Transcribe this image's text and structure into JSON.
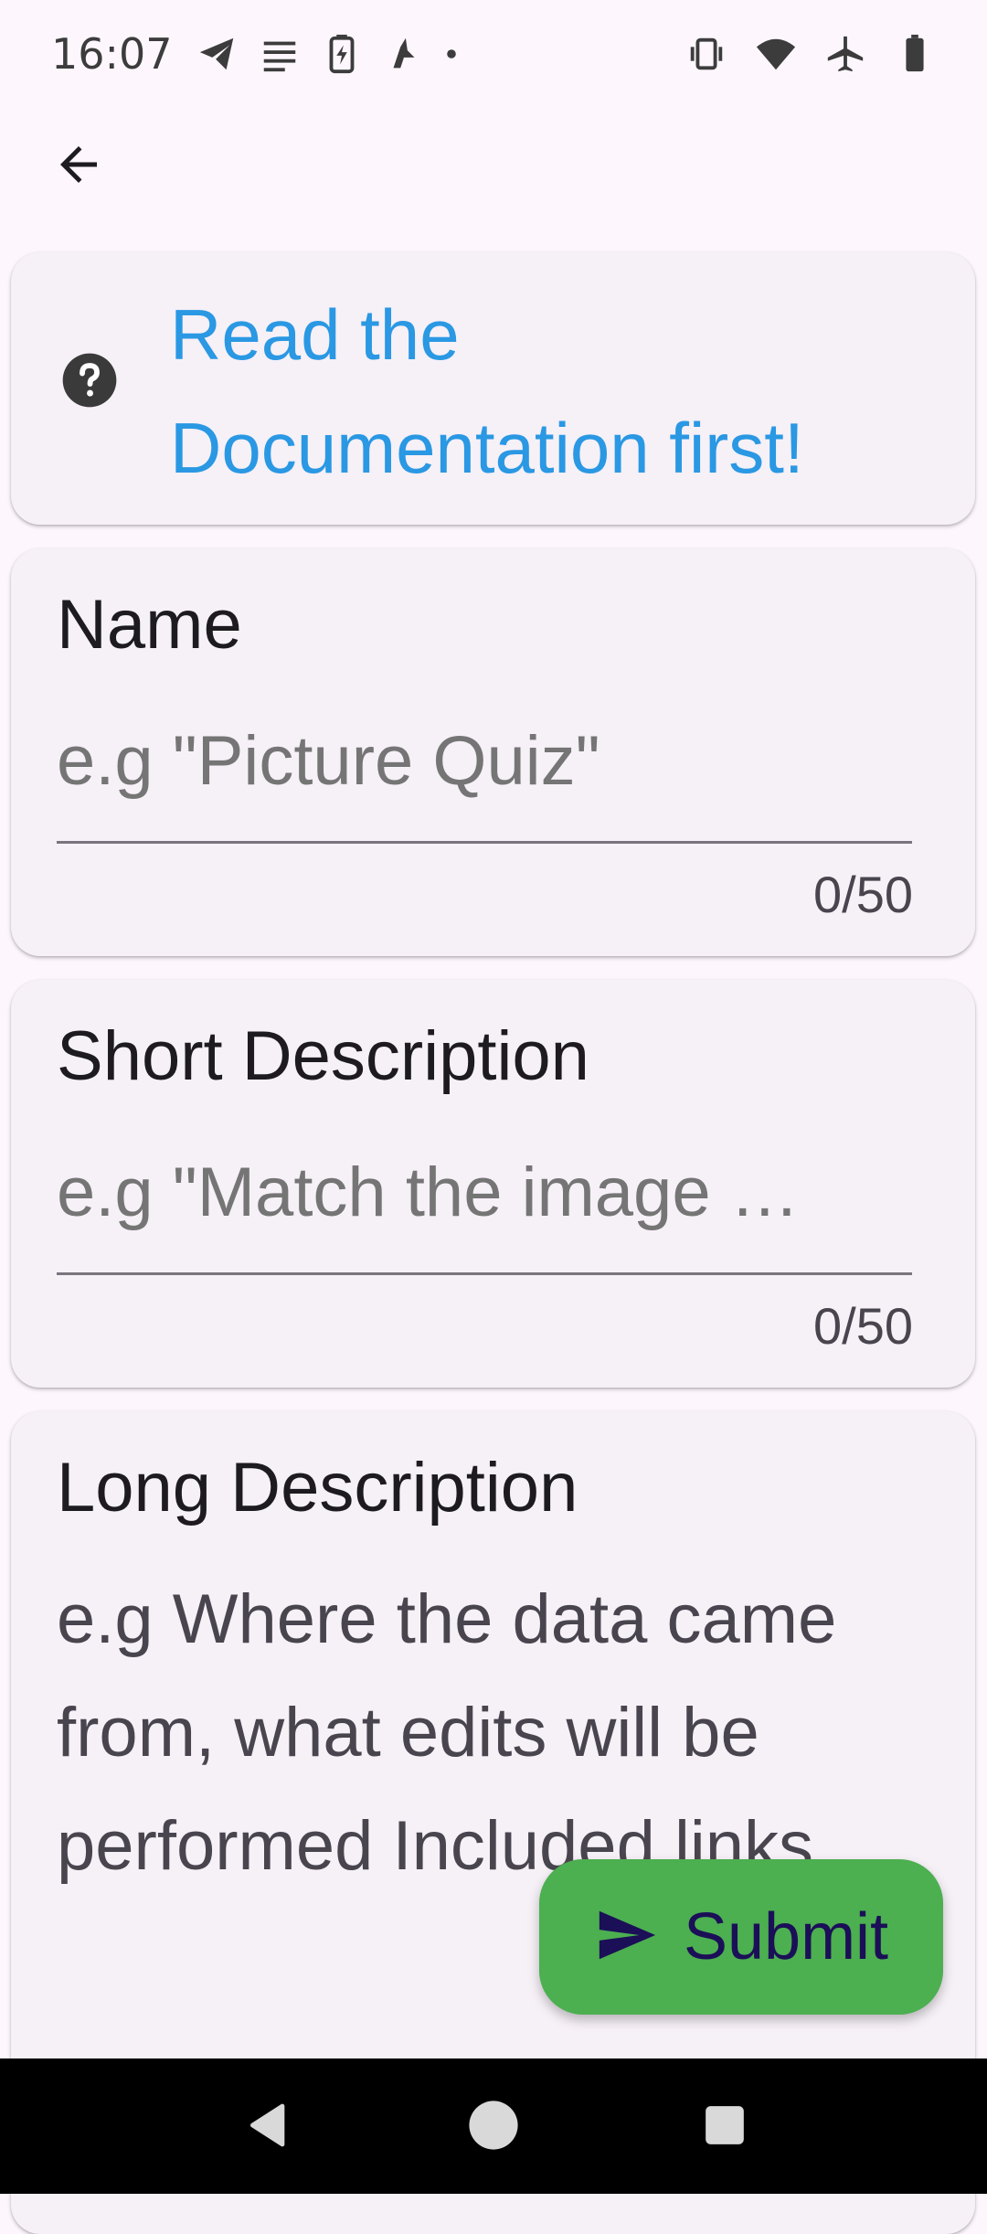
{
  "status_bar": {
    "time": "16:07",
    "left_icons": [
      "telegram-icon",
      "notes-icon",
      "battery-charging-icon",
      "app-notification-icon",
      "dot-icon"
    ],
    "right_icons": [
      "vibrate-icon",
      "wifi-icon",
      "airplane-icon",
      "battery-icon"
    ]
  },
  "doc_card": {
    "link_text": "Read the Documentation first!",
    "icon": "help-circle-icon",
    "link_color": "#2a98e3"
  },
  "fields": {
    "name": {
      "label": "Name",
      "placeholder": "e.g \"Picture Quiz\"",
      "counter": "0/50"
    },
    "short_description": {
      "label": "Short Description",
      "placeholder": "e.g \"Match the image …",
      "counter": "0/50"
    },
    "long_description": {
      "label": "Long Description",
      "placeholder": "e.g Where the data came from, what edits will be performed Included links"
    }
  },
  "fab": {
    "label": "Submit",
    "icon": "send-icon",
    "color": "#4caf50"
  },
  "nav_bar": {
    "buttons": [
      "back-triangle-icon",
      "home-circle-icon",
      "recents-square-icon"
    ]
  }
}
